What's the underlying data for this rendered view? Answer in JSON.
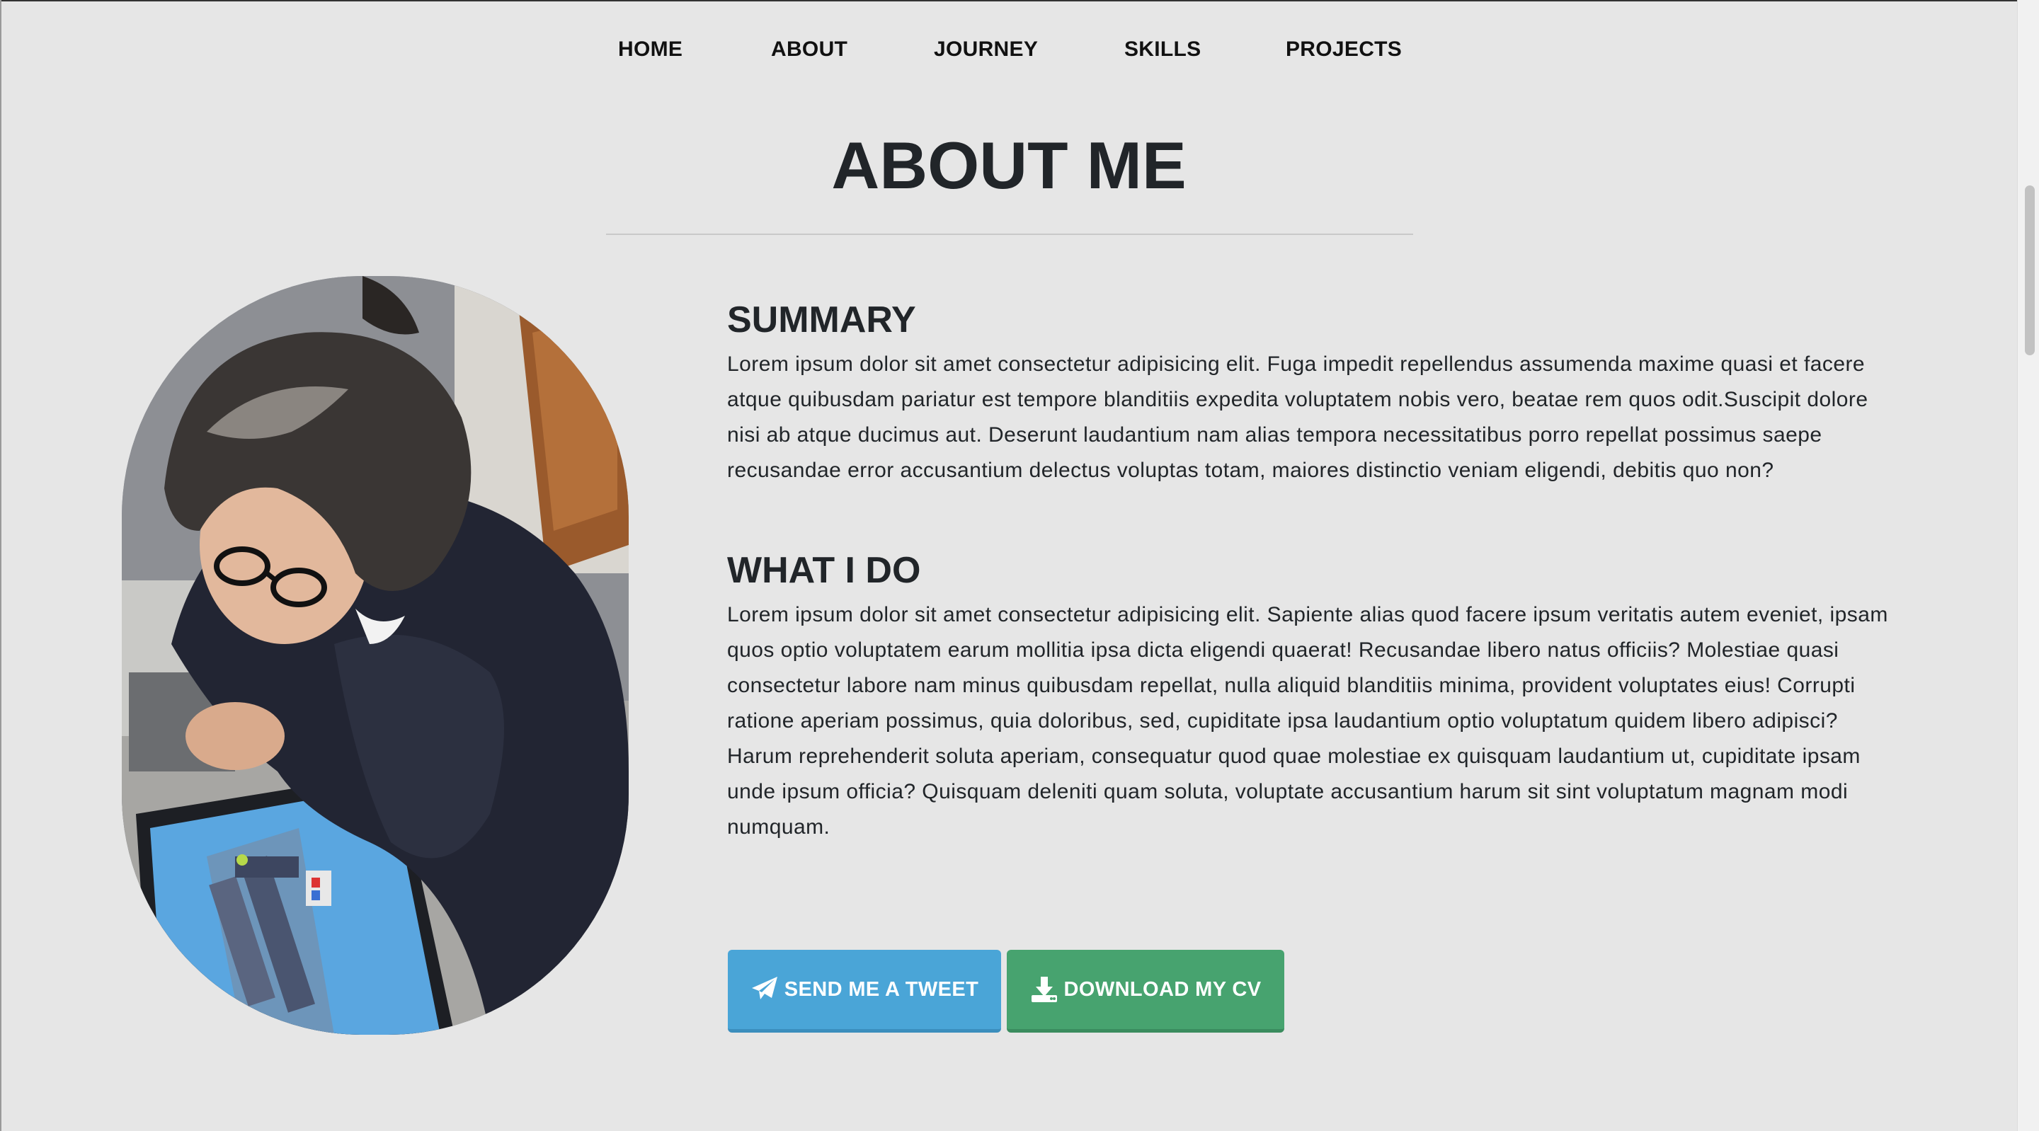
{
  "nav": {
    "items": [
      {
        "label": "HOME"
      },
      {
        "label": "ABOUT"
      },
      {
        "label": "JOURNEY"
      },
      {
        "label": "SKILLS"
      },
      {
        "label": "PROJECTS"
      }
    ]
  },
  "page": {
    "title": "ABOUT ME"
  },
  "summary": {
    "heading": "SUMMARY",
    "text": "Lorem ipsum dolor sit amet consectetur adipisicing elit. Fuga impedit repellendus assumenda maxime quasi et facere atque quibusdam pariatur est tempore blanditiis expedita voluptatem nobis vero, beatae rem quos odit.Suscipit dolore nisi ab atque ducimus aut. Deserunt laudantium nam alias tempora necessitatibus porro repellat possimus saepe recusandae error accusantium delectus voluptas totam, maiores distinctio veniam eligendi, debitis quo non?"
  },
  "what_i_do": {
    "heading": "WHAT I DO",
    "text": "Lorem ipsum dolor sit amet consectetur adipisicing elit. Sapiente alias quod facere ipsum veritatis autem eveniet, ipsam quos optio voluptatem earum mollitia ipsa dicta eligendi quaerat! Recusandae libero natus officiis? Molestiae quasi consectetur labore nam minus quibusdam repellat, nulla aliquid blanditiis minima, provident voluptates eius! Corrupti ratione aperiam possimus, quia doloribus, sed, cupiditate ipsa laudantium optio voluptatum quidem libero adipisci? Harum reprehenderit soluta aperiam, consequatur quod quae molestiae ex quisquam laudantium ut, cupiditate ipsam unde ipsum officia? Quisquam deleniti quam soluta, voluptate accusantium harum sit sint voluptatum magnam modi numquam."
  },
  "buttons": {
    "tweet": {
      "label": "SEND ME A TWEET",
      "icon": "paper-plane-icon",
      "color": "#4aa5d7"
    },
    "cv": {
      "label": "DOWNLOAD MY CV",
      "icon": "download-icon",
      "color": "#47a36f"
    }
  },
  "colors": {
    "background": "#e6e6e6",
    "text": "#212529"
  }
}
